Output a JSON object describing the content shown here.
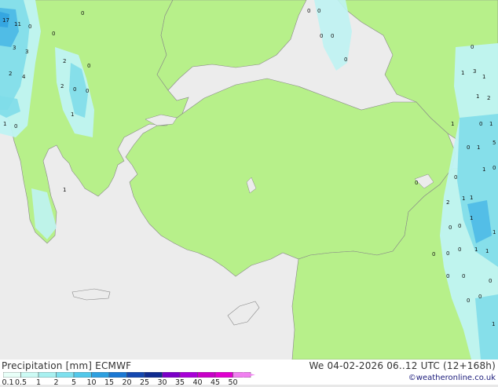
{
  "header": {
    "title_left": "Precipitation [mm] ECMWF",
    "title_right": "We 04-02-2026 06..12 UTC (12+168h)",
    "copyright": "©weatheronline.co.uk"
  },
  "legend": {
    "labels": [
      "0.1",
      "0.5",
      "1",
      "2",
      "5",
      "10",
      "15",
      "20",
      "25",
      "30",
      "35",
      "40",
      "45",
      "50"
    ],
    "colors": [
      "#e8fff8",
      "#ccfaf4",
      "#a8f0f0",
      "#7ee0ee",
      "#52c8ea",
      "#2ea0e0",
      "#1a78d4",
      "#1448b0",
      "#102c90",
      "#7b00c8",
      "#a800d8",
      "#c800c8",
      "#e000d0",
      "#f080f0"
    ]
  },
  "colors": {
    "land": "#b7f08a",
    "sea": "#ececec",
    "border": "#888888",
    "precip_light": "#bff3f3",
    "precip_medium": "#7fdde9",
    "precip_heavy": "#4ab8e6"
  },
  "map_values": [
    {
      "text": "17"
    },
    {
      "text": "11"
    },
    {
      "text": "0"
    },
    {
      "text": "0"
    },
    {
      "text": "0"
    },
    {
      "text": "3"
    },
    {
      "text": "3"
    },
    {
      "text": "2"
    },
    {
      "text": "4"
    },
    {
      "text": "2"
    },
    {
      "text": "2"
    },
    {
      "text": "0"
    },
    {
      "text": "0"
    },
    {
      "text": "0"
    },
    {
      "text": "1"
    },
    {
      "text": "1"
    },
    {
      "text": "0"
    },
    {
      "text": "1"
    },
    {
      "text": "0"
    },
    {
      "text": "0"
    },
    {
      "text": "0"
    },
    {
      "text": "0"
    },
    {
      "text": "0"
    },
    {
      "text": "0"
    },
    {
      "text": "1"
    },
    {
      "text": "3"
    },
    {
      "text": "1"
    },
    {
      "text": "1"
    },
    {
      "text": "2"
    },
    {
      "text": "1"
    },
    {
      "text": "0"
    },
    {
      "text": "1"
    },
    {
      "text": "5"
    },
    {
      "text": "0"
    },
    {
      "text": "1"
    },
    {
      "text": "0"
    },
    {
      "text": "0"
    },
    {
      "text": "1"
    },
    {
      "text": "0"
    },
    {
      "text": "2"
    },
    {
      "text": "1"
    },
    {
      "text": "1"
    },
    {
      "text": "0"
    },
    {
      "text": "0"
    },
    {
      "text": "1"
    },
    {
      "text": "1"
    },
    {
      "text": "0"
    },
    {
      "text": "0"
    },
    {
      "text": "0"
    },
    {
      "text": "1"
    },
    {
      "text": "1"
    },
    {
      "text": "0"
    },
    {
      "text": "0"
    },
    {
      "text": "0"
    },
    {
      "text": "0"
    },
    {
      "text": "0"
    },
    {
      "text": "1"
    }
  ]
}
